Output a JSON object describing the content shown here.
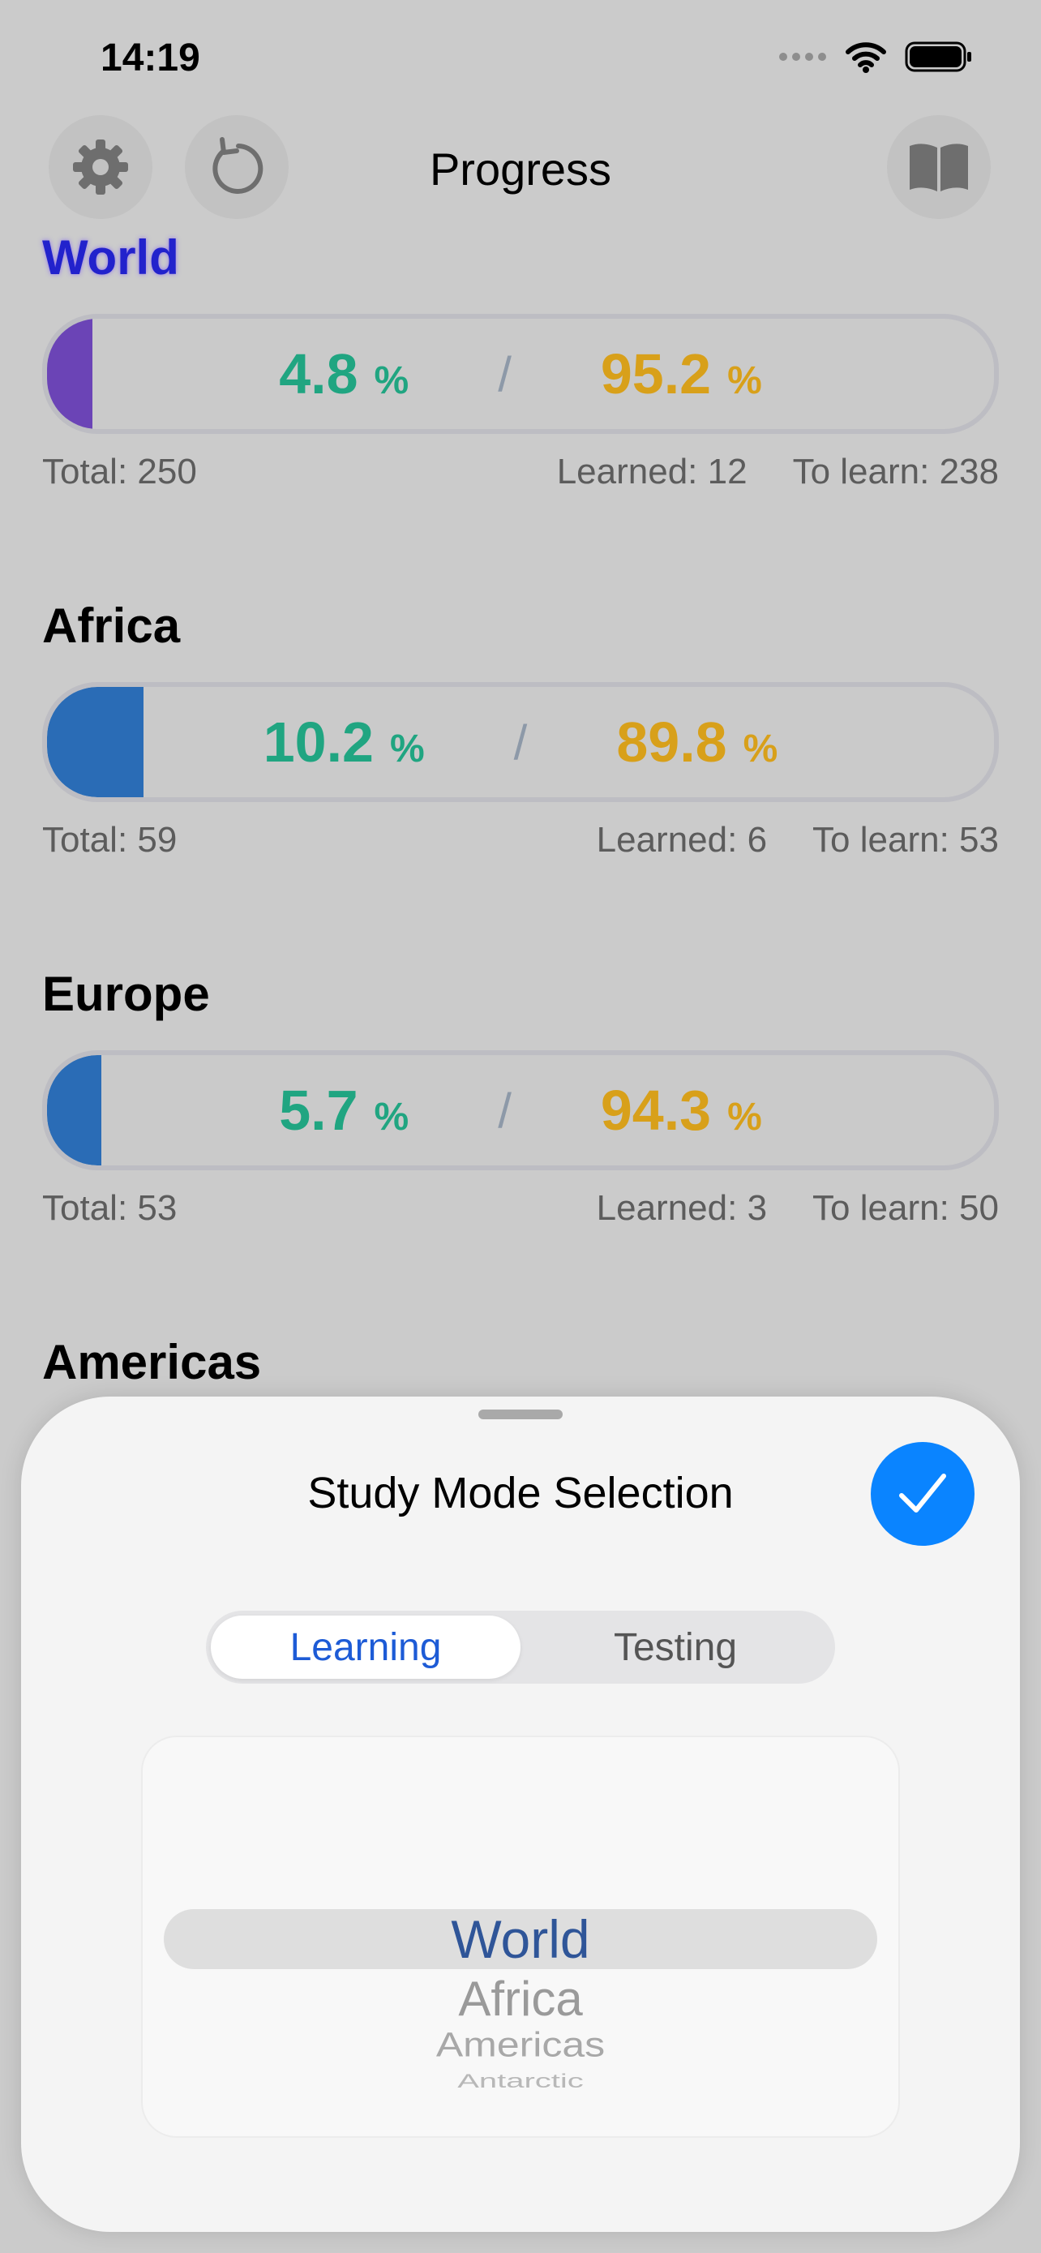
{
  "status_bar": {
    "time": "14:19"
  },
  "nav": {
    "title": "Progress"
  },
  "regions": [
    {
      "name": "World",
      "learned_pct": "4.8",
      "to_learn_pct": "95.2",
      "pct_symbol": "%",
      "fill_fraction": 0.048,
      "fill_color": "#6b44b6",
      "total_label": "Total:",
      "total": "250",
      "learned_label": "Learned:",
      "learned": "12",
      "to_learn_label": "To learn:",
      "to_learn": "238"
    },
    {
      "name": "Africa",
      "learned_pct": "10.2",
      "to_learn_pct": "89.8",
      "pct_symbol": "%",
      "fill_fraction": 0.102,
      "fill_color": "#2a6cb6",
      "total_label": "Total:",
      "total": "59",
      "learned_label": "Learned:",
      "learned": "6",
      "to_learn_label": "To learn:",
      "to_learn": "53"
    },
    {
      "name": "Europe",
      "learned_pct": "5.7",
      "to_learn_pct": "94.3",
      "pct_symbol": "%",
      "fill_fraction": 0.057,
      "fill_color": "#2a6cb6",
      "total_label": "Total:",
      "total": "53",
      "learned_label": "Learned:",
      "learned": "3",
      "to_learn_label": "To learn:",
      "to_learn": "50"
    },
    {
      "name": "Americas"
    }
  ],
  "separator": "/",
  "sheet": {
    "title": "Study Mode Selection",
    "segments": [
      {
        "label": "Learning",
        "selected": true
      },
      {
        "label": "Testing",
        "selected": false
      }
    ],
    "picker_items": [
      "World",
      "Africa",
      "Americas",
      "Antarctic"
    ],
    "selected_item": "World"
  },
  "colors": {
    "accent": "#0a84ff",
    "learned": "#20a581",
    "to_learn": "#d8a01a"
  }
}
